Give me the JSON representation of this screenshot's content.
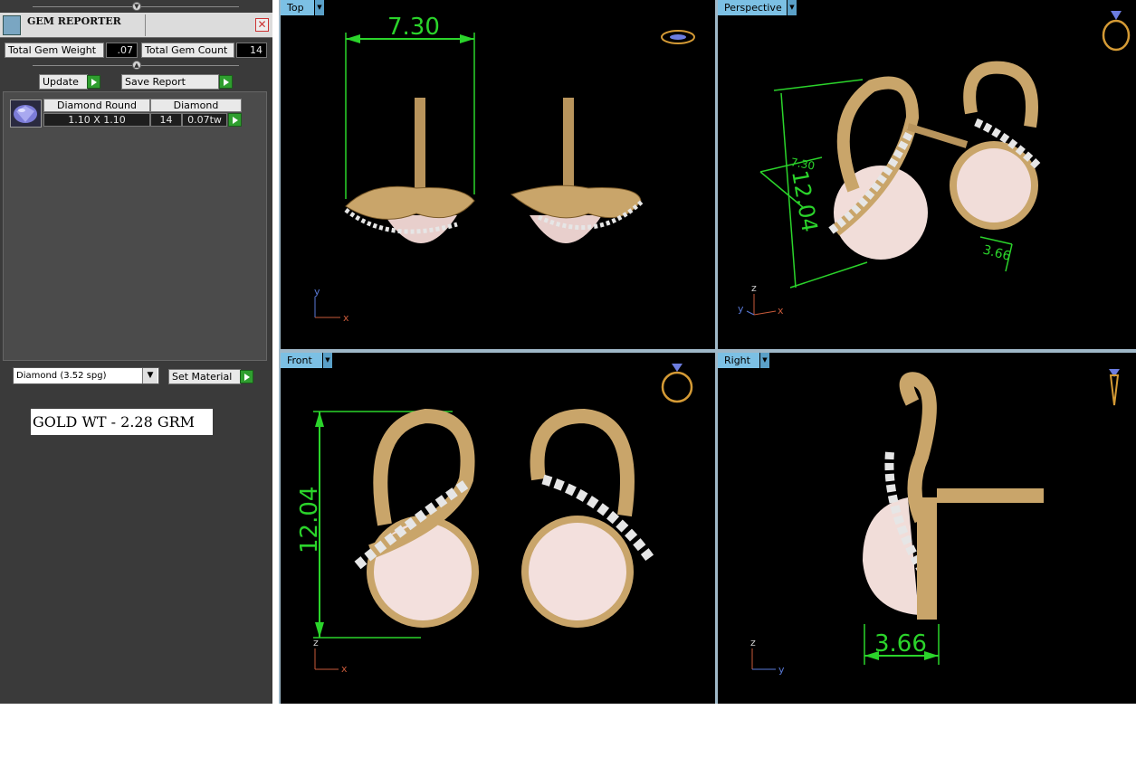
{
  "panel": {
    "title": "GEM REPORTER",
    "close_symbol": "✕",
    "total_gem_weight_label": "Total Gem Weight",
    "total_gem_weight_value": ".07",
    "total_gem_count_label": "Total Gem Count",
    "total_gem_count_value": "14",
    "update_label": "Update",
    "save_report_label": "Save Report",
    "gem_table": {
      "header_name": "Diamond Round",
      "header_type": "Diamond",
      "size": "1.10 X 1.10",
      "count": "14",
      "weight": "0.07tw"
    },
    "material_select": "Diamond    (3.52 spg)",
    "set_material_label": "Set Material",
    "gold_weight": "GOLD WT - 2.28 GRM"
  },
  "viewports": {
    "top": {
      "label": "Top",
      "dim_width": "7.30"
    },
    "perspective": {
      "label": "Perspective",
      "dim_width": "7.30",
      "dim_height": "12.04",
      "dim_depth": "3.66"
    },
    "front": {
      "label": "Front",
      "dim_height": "12.04"
    },
    "right": {
      "label": "Right",
      "dim_depth": "3.66"
    }
  },
  "axes": {
    "x": "x",
    "y": "y",
    "z": "z"
  },
  "colors": {
    "dimension": "#2bd42b",
    "tab": "#7cc0e4",
    "gold": "#c9a56a",
    "pearl": "#f3dcd8"
  }
}
